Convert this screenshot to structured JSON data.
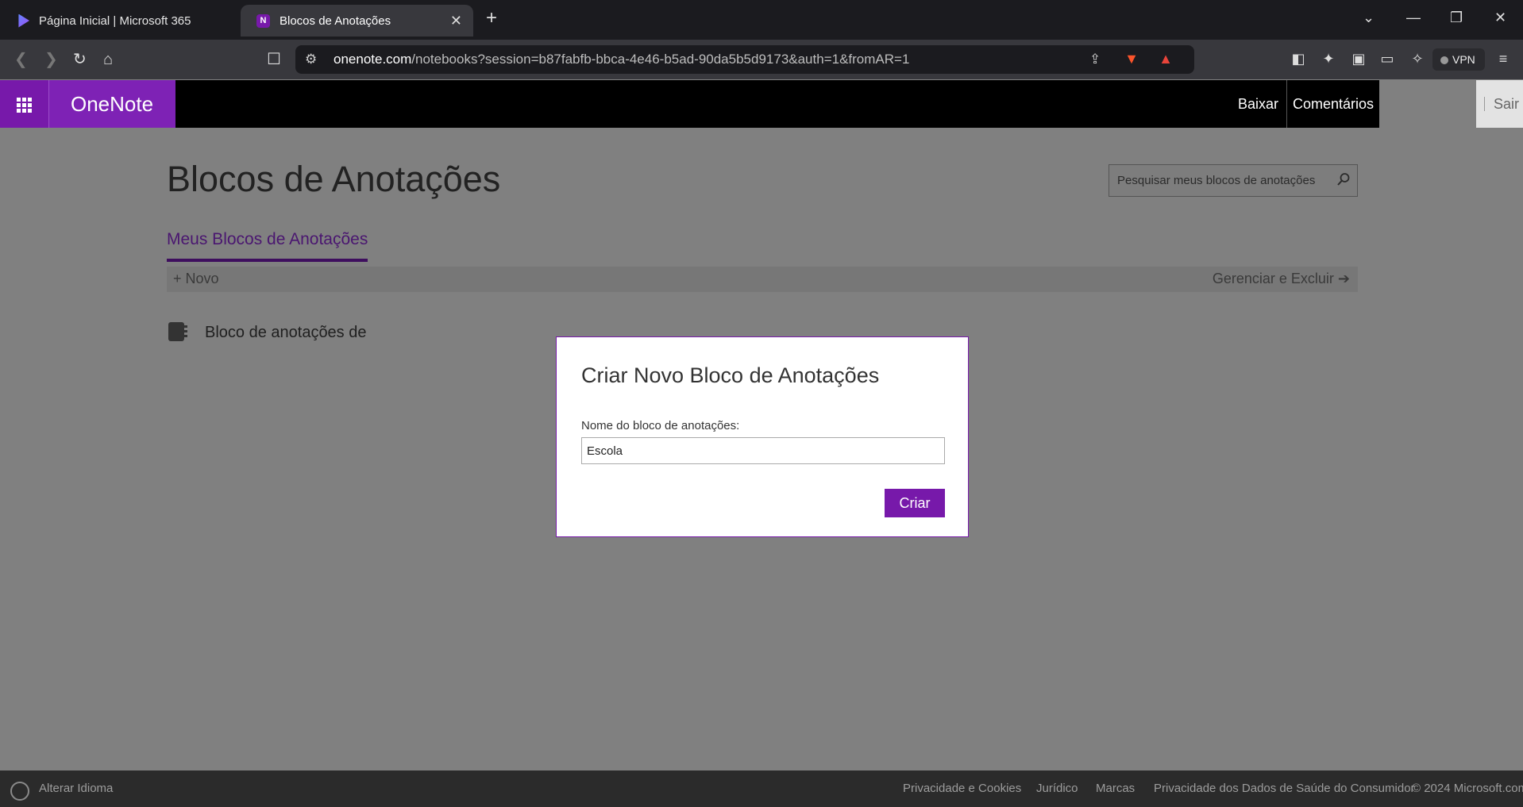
{
  "browser": {
    "tabs": [
      {
        "title": "Página Inicial | Microsoft 365",
        "icon": "microsoft365-icon",
        "active": false
      },
      {
        "title": "Blocos de Anotações",
        "icon": "onenote-icon",
        "active": true
      }
    ],
    "url_host": "onenote.com",
    "url_path": "/notebooks?session=b87fabfb-bbca-4e46-b5ad-90da5b5d9173&auth=1&fromAR=1",
    "vpn_label": "VPN",
    "brave_badge": "1"
  },
  "header": {
    "app_name": "OneNote",
    "links": [
      "Baixar",
      "Comentários"
    ],
    "signout": "Sair"
  },
  "main": {
    "title": "Blocos de Anotações",
    "search_placeholder": "Pesquisar meus blocos de anotações",
    "pivot": "Meus Blocos de Anotações",
    "new_label": "Novo",
    "manage_label": "Gerenciar e Excluir",
    "notebooks": [
      {
        "name": "Bloco de anotações de"
      }
    ]
  },
  "dialog": {
    "title": "Criar Novo Bloco de Anotações",
    "name_label": "Nome do bloco de anotações:",
    "name_value": "Escola",
    "create_button": "Criar"
  },
  "footer": {
    "language": "Alterar Idioma",
    "links": [
      "Privacidade e Cookies",
      "Jurídico",
      "Marcas",
      "Privacidade dos Dados de Saúde do Consumidor"
    ],
    "copyright": "© 2024 Microsoft.com"
  },
  "colors": {
    "brand": "#7719aa",
    "overlay": "#808080",
    "header": "#000000"
  }
}
